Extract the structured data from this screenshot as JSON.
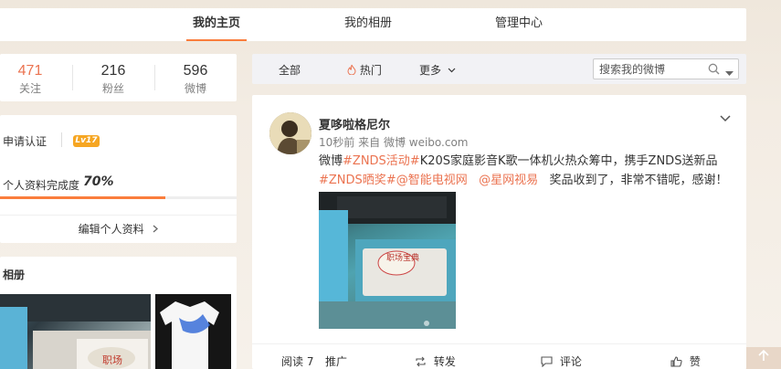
{
  "nav": {
    "home": "我的主页",
    "album": "我的相册",
    "admin": "管理中心"
  },
  "stats": [
    {
      "count": "471",
      "label": "关注"
    },
    {
      "count": "216",
      "label": "粉丝"
    },
    {
      "count": "596",
      "label": "微博"
    }
  ],
  "profile": {
    "verify_label": "申请认证",
    "level": "Lv17",
    "completion_label": "个人资料完成度",
    "completion_value": "70%",
    "completion_fraction": 0.7,
    "edit_label": "编辑个人资料"
  },
  "album": {
    "title": "相册"
  },
  "feed_bar": {
    "tab_all": "全部",
    "tab_hot": "热门",
    "tab_more": "更多",
    "search_placeholder": "搜索我的微博"
  },
  "post": {
    "username": "夏哆啦格尼尔",
    "time": "10秒前",
    "source_prefix": "来自",
    "source": "微博 weibo.com",
    "text_part1": "微博",
    "topic1": "#ZNDS活动#",
    "text_part2": "K20S家庭影音K歌一体机火热众筹中，携手ZNDS送新品",
    "topic2": "#ZNDS晒奖#",
    "mention1": "@智能电视网",
    "mention2": "@星网视易",
    "text_part3": "奖品收到了，非常不错呢，感谢！",
    "image_caption": "职场宝典"
  },
  "actions": {
    "read": "阅读 7",
    "promote": "推广",
    "repost": "转发",
    "comment": "评论",
    "like": "赞"
  },
  "colors": {
    "accent": "#fa7d3c",
    "link": "#eb7350",
    "level_badge": "#f6a623"
  }
}
